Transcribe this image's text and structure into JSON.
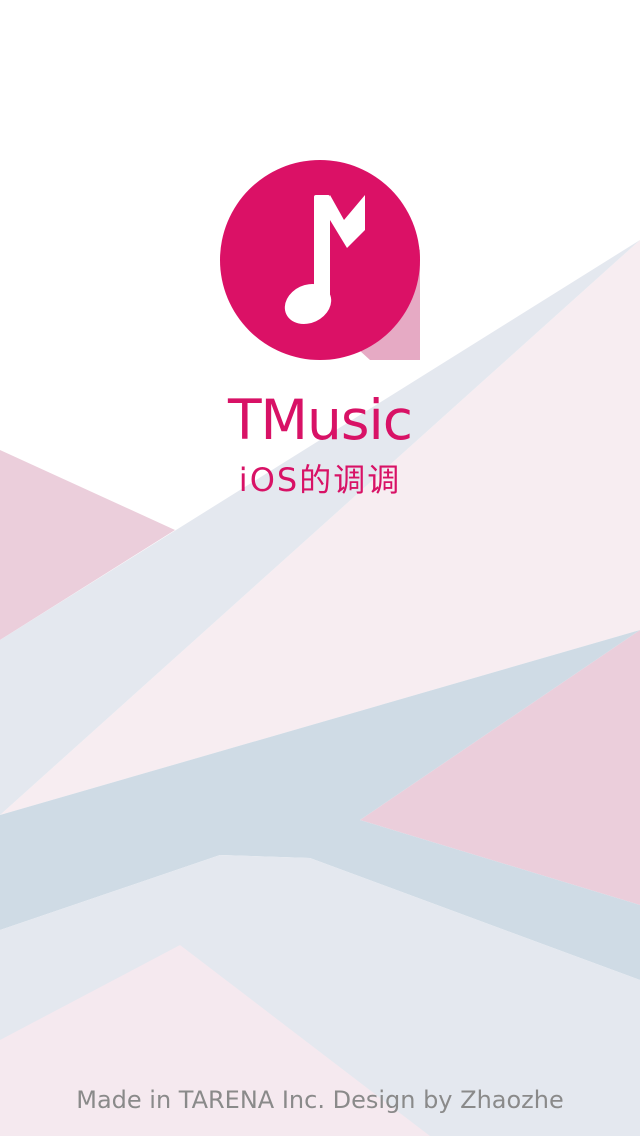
{
  "app": {
    "name": "TMusic",
    "tagline": "iOS的调调",
    "logo_icon": "music-note-icon"
  },
  "footer": {
    "credit": "Made in TARENA Inc. Design by Zhaozhe"
  },
  "colors": {
    "brand": "#d81266",
    "logo_circle": "#db1166",
    "note": "#ffffff",
    "background": "#ffffff",
    "pink_shape": "#ebcedb",
    "blush_shape": "#f7edf1",
    "gray_blue_shape": "#e4e8ef",
    "slate_shape": "#cfdbe5",
    "light_pink_shape": "#f5e9ef",
    "footer_text": "#8a8a8a"
  }
}
